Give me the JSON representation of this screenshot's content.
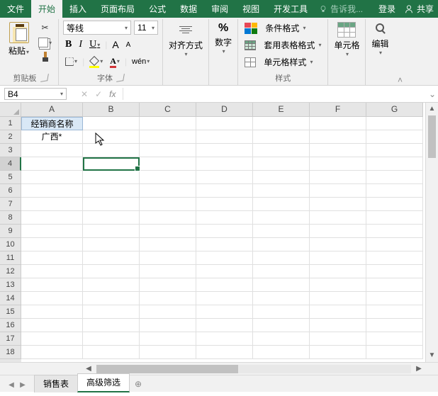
{
  "tabs": {
    "file": "文件",
    "home": "开始",
    "insert": "插入",
    "layout": "页面布局",
    "formulas": "公式",
    "data": "数据",
    "review": "审阅",
    "view": "视图",
    "dev": "开发工具",
    "tell": "告诉我...",
    "login": "登录",
    "share": "共享"
  },
  "ribbon": {
    "clipboard": {
      "paste": "粘贴",
      "label": "剪贴板"
    },
    "font": {
      "name": "等线",
      "size": "11",
      "bold": "B",
      "italic": "I",
      "underline": "U",
      "bigA": "A",
      "smallA": "A",
      "wen": "wén",
      "fontA": "A",
      "label": "字体"
    },
    "alignment": {
      "label": "对齐方式"
    },
    "number": {
      "sym": "%",
      "label": "数字"
    },
    "styles": {
      "cond": "条件格式",
      "table": "套用表格格式",
      "cell": "单元格样式",
      "label": "样式"
    },
    "cells": {
      "label": "单元格"
    },
    "editing": {
      "label": "编辑"
    }
  },
  "namebox": "B4",
  "fx": "fx",
  "columns": [
    "A",
    "B",
    "C",
    "D",
    "E",
    "F",
    "G"
  ],
  "rows": [
    "1",
    "2",
    "3",
    "4",
    "5",
    "6",
    "7",
    "8",
    "9",
    "10",
    "11",
    "12",
    "13",
    "14",
    "15",
    "16",
    "17",
    "18"
  ],
  "cellsData": {
    "A1": "经销商名称",
    "A2": "广西*"
  },
  "sheets": {
    "s1": "销售表",
    "s2": "高级筛选",
    "add": "⊕"
  }
}
